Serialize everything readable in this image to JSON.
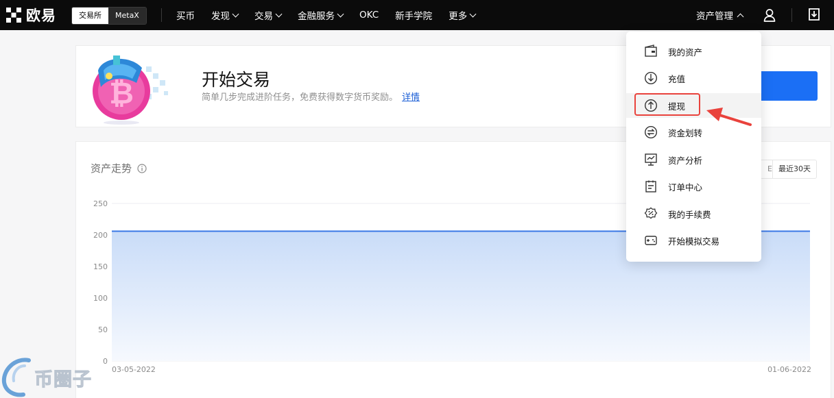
{
  "nav": {
    "logo_text": "欧易",
    "seg": [
      "交易所",
      "MetaX"
    ],
    "items": [
      "买币",
      "发现",
      "交易",
      "金融服务",
      "OKC",
      "新手学院",
      "更多"
    ],
    "asset_mgmt": "资产管理"
  },
  "hero": {
    "title": "开始交易",
    "subtitle": "简单几步完成进阶任务，免费获得数字货币奖励。",
    "link": "详情"
  },
  "chart": {
    "title": "资产走势",
    "range_prev": "E",
    "range_30": "最近30天"
  },
  "chart_data": {
    "type": "area",
    "x": [
      "03-05-2022",
      "01-06-2022"
    ],
    "values": [
      206,
      206
    ],
    "yticks": [
      0,
      50,
      100,
      150,
      200,
      250
    ],
    "ylim": [
      0,
      250
    ],
    "line_color": "#3a78e6",
    "grid": true
  },
  "dropdown": {
    "items": [
      {
        "label": "我的资产",
        "icon": "wallet-icon"
      },
      {
        "label": "充值",
        "icon": "deposit-icon"
      },
      {
        "label": "提现",
        "icon": "withdraw-icon"
      },
      {
        "label": "资金划转",
        "icon": "transfer-icon"
      },
      {
        "label": "资产分析",
        "icon": "analysis-icon"
      },
      {
        "label": "订单中心",
        "icon": "order-icon"
      },
      {
        "label": "我的手续费",
        "icon": "fee-icon"
      },
      {
        "label": "开始模拟交易",
        "icon": "demo-trading-icon"
      }
    ]
  },
  "watermark": "币圈子",
  "colors": {
    "topbar": "#0b0b0b",
    "accent": "#1b6ff5",
    "highlight": "#e9423c"
  }
}
